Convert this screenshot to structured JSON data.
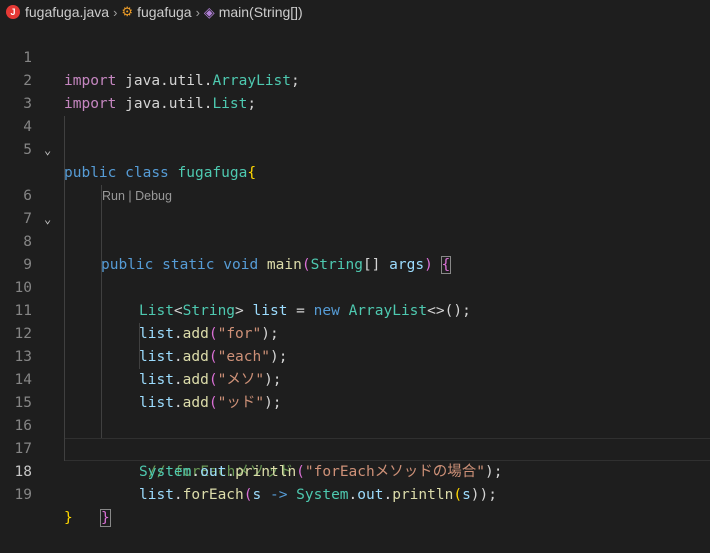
{
  "breadcrumb": {
    "file": "fugafuga.java",
    "class": "fugafuga",
    "method": "main(String[])"
  },
  "codelens": "Run | Debug",
  "line_numbers": [
    "1",
    "2",
    "3",
    "4",
    "5",
    "6",
    "7",
    "8",
    "9",
    "10",
    "11",
    "12",
    "13",
    "14",
    "15",
    "16",
    "17",
    "18",
    "19"
  ],
  "code": {
    "l1": {
      "kw": "import",
      "pkg": "java.util.",
      "type": "ArrayList",
      "end": ";"
    },
    "l2": {
      "kw": "import",
      "pkg": "java.util.",
      "type": "List",
      "end": ";"
    },
    "l4": {
      "mod": "public",
      "kw": "class",
      "name": "fugafuga",
      "brace": "{"
    },
    "l6": {
      "mod": "public",
      "stat": "static",
      "void": "void",
      "name": "main",
      "open": "(",
      "type": "String",
      "arr": "[]",
      "arg": "args",
      "close": ")",
      "brace": "{"
    },
    "l8": {
      "type": "List",
      "lt": "<",
      "gtype": "String",
      "gt": ">",
      "var": "list",
      "eq": " = ",
      "new": "new",
      "ctor": "ArrayList",
      "diamond": "<>",
      "paren": "();"
    },
    "l9": {
      "var": "list",
      "dot": ".",
      "fn": "add",
      "open": "(",
      "str": "\"for\"",
      "close": ");"
    },
    "l10": {
      "var": "list",
      "dot": ".",
      "fn": "add",
      "open": "(",
      "str": "\"each\"",
      "close": ");"
    },
    "l11": {
      "var": "list",
      "dot": ".",
      "fn": "add",
      "open": "(",
      "str": "\"メソ\"",
      "close": ");"
    },
    "l12": {
      "var": "list",
      "dot": ".",
      "fn": "add",
      "open": "(",
      "str": "\"ッド\"",
      "close": ");"
    },
    "l14": {
      "comment": "// forEachメソッド"
    },
    "l15": {
      "type": "System",
      "dot1": ".",
      "out": "out",
      "dot2": ".",
      "fn": "println",
      "open": "(",
      "str": "\"forEachメソッドの場合\"",
      "close": ");"
    },
    "l16": {
      "var": "list",
      "dot1": ".",
      "fn": "forEach",
      "open": "(",
      "param": "s",
      "arrow": " -> ",
      "type": "System",
      "dot2": ".",
      "out": "out",
      "dot3": ".",
      "fn2": "println",
      "open2": "(",
      "arg": "s",
      "close": "));"
    },
    "l18": {
      "brace": "}"
    },
    "l19": {
      "brace": "}"
    }
  }
}
